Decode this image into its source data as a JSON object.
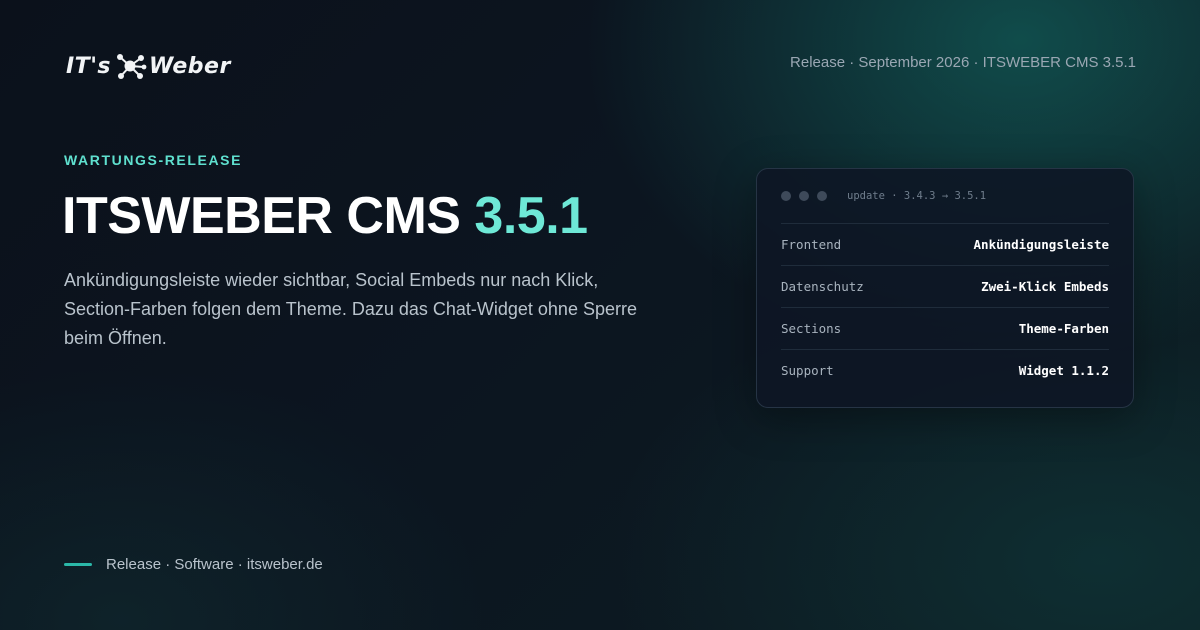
{
  "brand": {
    "logo_left": "IT's",
    "logo_right": "Weber",
    "logo_icon": "molecule-icon"
  },
  "header": {
    "meta": "Release · September 2026 · ITSWEBER CMS 3.5.1"
  },
  "hero": {
    "eyebrow": "WARTUNGS-RELEASE",
    "title_main": "ITSWEBER CMS ",
    "title_version": "3.5.1",
    "description": "Ankündigungsleiste wieder sichtbar, Social Embeds nur nach Klick, Section-Farben folgen dem Theme. Dazu das Chat-Widget ohne Sperre beim Öffnen."
  },
  "card": {
    "path": "update · 3.4.3 → 3.5.1",
    "rows": [
      {
        "label": "Frontend",
        "value": "Ankündigungsleiste"
      },
      {
        "label": "Datenschutz",
        "value": "Zwei-Klick Embeds"
      },
      {
        "label": "Sections",
        "value": "Theme-Farben"
      },
      {
        "label": "Support",
        "value": "Widget 1.1.2"
      }
    ]
  },
  "footer": {
    "text": "Release · Software · itsweber.de"
  },
  "colors": {
    "accent": "#6ee8d6",
    "eyebrow": "#5fe0cf",
    "background": "#0c1520"
  }
}
